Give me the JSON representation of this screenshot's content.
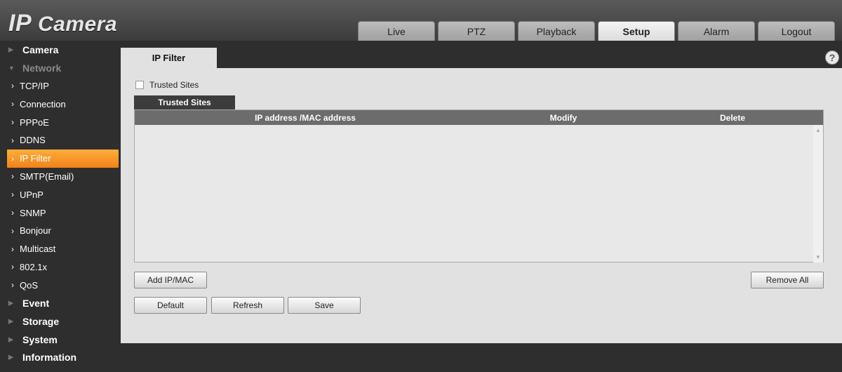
{
  "app": {
    "logo_ip": "IP",
    "logo_camera": "Camera"
  },
  "tabs": [
    {
      "label": "Live",
      "active": false
    },
    {
      "label": "PTZ",
      "active": false
    },
    {
      "label": "Playback",
      "active": false
    },
    {
      "label": "Setup",
      "active": true
    },
    {
      "label": "Alarm",
      "active": false
    },
    {
      "label": "Logout",
      "active": false
    }
  ],
  "sidebar": {
    "camera": "Camera",
    "network": "Network",
    "network_items": [
      "TCP/IP",
      "Connection",
      "PPPoE",
      "DDNS",
      "IP Filter",
      "SMTP(Email)",
      "UPnP",
      "SNMP",
      "Bonjour",
      "Multicast",
      "802.1x",
      "QoS"
    ],
    "active_item": "IP Filter",
    "event": "Event",
    "storage": "Storage",
    "system": "System",
    "information": "Information"
  },
  "page": {
    "tab_label": "IP Filter",
    "help_symbol": "?",
    "trusted_checkbox_label": "Trusted Sites",
    "trusted_checked": false,
    "list_tab_label": "Trusted Sites",
    "columns": {
      "ip": "IP address /MAC address",
      "modify": "Modify",
      "delete": "Delete"
    },
    "rows": [],
    "buttons": {
      "add": "Add IP/MAC",
      "remove_all": "Remove All",
      "default": "Default",
      "refresh": "Refresh",
      "save": "Save"
    }
  },
  "colors": {
    "accent": "#f0821a",
    "content_bg": "#e1e1e1",
    "chrome_bg": "#2e2e2e",
    "list_header": "#6c6c6c"
  }
}
